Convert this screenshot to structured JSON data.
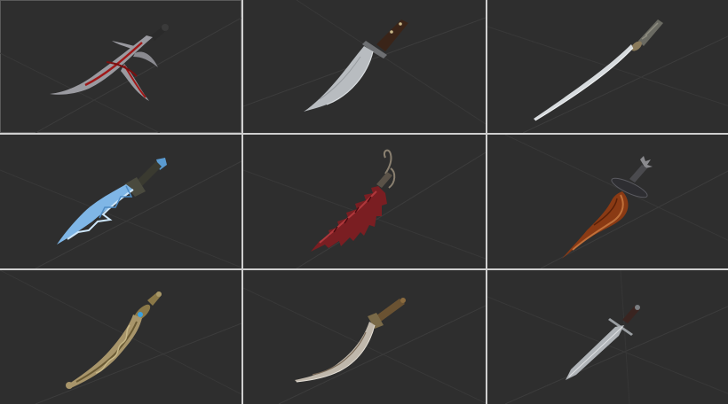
{
  "gallery": {
    "columns": 3,
    "rows": 3,
    "cell_background": "#2e2e2e",
    "divider_color": "#cfcfcf",
    "grid_line_color": "#3c3c3c",
    "items": [
      {
        "icon": "twisted-crimson-scythe-blade-icon",
        "colors": {
          "blade": "#9a9aa0",
          "accent": "#a01818",
          "grip": "#2a2a2a"
        }
      },
      {
        "icon": "curved-scimitar-knife-icon",
        "colors": {
          "blade": "#b8bcc0",
          "guard": "#6d6f72",
          "grip": "#3a2418"
        }
      },
      {
        "icon": "katana-icon",
        "colors": {
          "blade": "#d6dadd",
          "guard": "#8a7a5a",
          "grip": "#6a6a62"
        }
      },
      {
        "icon": "ice-crystal-dagger-icon",
        "colors": {
          "blade": "#7fb6e6",
          "highlight": "#cde6fa",
          "grip": "#3a3a30"
        }
      },
      {
        "icon": "bloody-serrated-flesh-blade-icon",
        "colors": {
          "blade": "#7a1e22",
          "highlight": "#b0383c",
          "grip": "#8a8070"
        }
      },
      {
        "icon": "bronze-flame-kris-dagger-icon",
        "colors": {
          "blade": "#8a3a14",
          "highlight": "#c0703a",
          "guard": "#3a3a3e"
        }
      },
      {
        "icon": "ornate-golden-dagger-icon",
        "colors": {
          "blade": "#a8956a",
          "gem": "#3aa0e0",
          "grip": "#8a7848"
        }
      },
      {
        "icon": "curved-shamshir-blade-icon",
        "colors": {
          "blade": "#c0b8ac",
          "edge": "#7a6a58",
          "grip": "#6a5232"
        }
      },
      {
        "icon": "straight-steel-dagger-icon",
        "colors": {
          "blade": "#b0b4b8",
          "guard": "#9a9ea2",
          "grip": "#3a2420"
        }
      }
    ]
  }
}
